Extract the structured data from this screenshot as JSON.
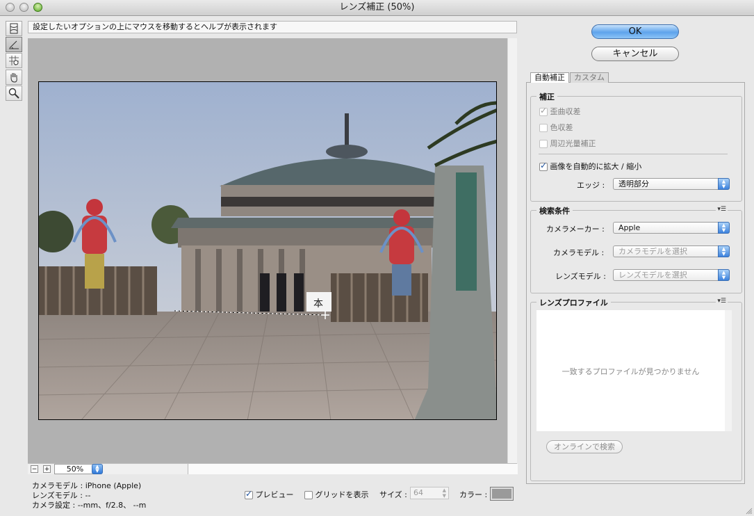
{
  "window": {
    "title": "レンズ補正 (50%)"
  },
  "hint": "設定したいオプションの上にマウスを移動するとヘルプが表示されます",
  "tools": [
    "straighten-grid-tool",
    "straighten-tool",
    "move-grid-tool",
    "hand-tool",
    "zoom-tool"
  ],
  "zoom": {
    "minus": "−",
    "plus": "+",
    "value": "50%"
  },
  "info": {
    "camera_model": "カメラモデル : iPhone (Apple)",
    "lens_model": "レンズモデル : --",
    "camera_settings": "カメラ設定 : --mm、f/2.8、 --m"
  },
  "bottom": {
    "preview_label": "プレビュー",
    "grid_label": "グリッドを表示",
    "size_label": "サイズ :",
    "size_value": "64",
    "color_label": "カラー :",
    "color_value": "#9a9a9a"
  },
  "buttons": {
    "ok": "OK",
    "cancel": "キャンセル"
  },
  "tabs": {
    "auto": "自動補正",
    "custom": "カスタム"
  },
  "correction": {
    "title": "補正",
    "distortion": "歪曲収差",
    "chromatic": "色収差",
    "vignette": "周辺光量補正",
    "auto_scale": "画像を自動的に拡大 / 縮小",
    "edge_label": "エッジ :",
    "edge_value": "透明部分"
  },
  "search": {
    "title": "検索条件",
    "maker_label": "カメラメーカー :",
    "maker_value": "Apple",
    "model_label": "カメラモデル :",
    "model_value": "カメラモデルを選択",
    "lens_label": "レンズモデル :",
    "lens_value": "レンズモデルを選択"
  },
  "profile": {
    "title": "レンズプロファイル",
    "empty": "一致するプロファイルが見つかりません",
    "online_search": "オンラインで検索"
  },
  "photo": {
    "sign_text": "本"
  },
  "colors": {
    "accent": "#3c82dd",
    "canvas": "#b1b1b1"
  }
}
